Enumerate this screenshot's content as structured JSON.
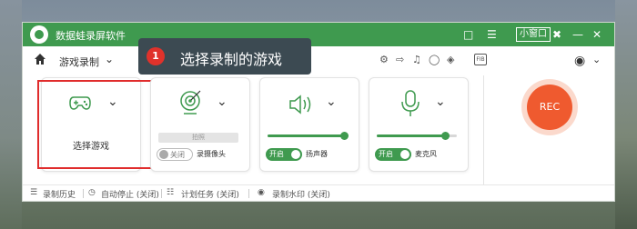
{
  "app": {
    "title": "数据蛙录屏软件",
    "mini_window": "小窗口"
  },
  "toolbar": {
    "mode_label": "游戏录制",
    "fib_label": "FIB"
  },
  "cards": {
    "game": {
      "label": "选择游戏"
    },
    "camera": {
      "photo_label": "拍照",
      "toggle_label": "关闭",
      "caption": "录摄像头"
    },
    "speaker": {
      "toggle_label": "开启",
      "caption": "扬声器",
      "level": 0.95
    },
    "mic": {
      "toggle_label": "开启",
      "caption": "麦克风",
      "level": 0.85
    }
  },
  "rec_button": {
    "label": "REC"
  },
  "status": {
    "history": "录制历史",
    "auto_stop": "自动停止 (关闭)",
    "schedule": "计划任务 (关闭)",
    "watermark": "录制水印 (关闭)"
  },
  "tooltip": {
    "number": "1",
    "text": "选择录制的游戏"
  },
  "colors": {
    "brand_green": "#3f9a4f",
    "rec_orange": "#ef5a2f",
    "highlight_red": "#e02c2c"
  }
}
